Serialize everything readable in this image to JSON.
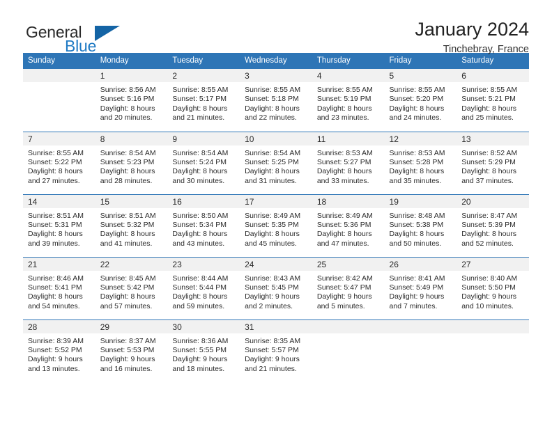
{
  "brand": {
    "name_top": "General",
    "name_bottom": "Blue",
    "flag_icon": "triangle-flag-icon",
    "accent_color": "#1f7ac4"
  },
  "header": {
    "title": "January 2024",
    "subtitle": "Tinchebray, France"
  },
  "theme": {
    "header_row_color": "#2e75b6",
    "daynum_band_color": "#f1f1f1",
    "row_divider_color": "#2e75b6"
  },
  "calendar": {
    "weekday_headers": [
      "Sunday",
      "Monday",
      "Tuesday",
      "Wednesday",
      "Thursday",
      "Friday",
      "Saturday"
    ],
    "weeks": [
      [
        {
          "day": "",
          "empty": true,
          "sunrise": "",
          "sunset": "",
          "daylight1": "",
          "daylight2": ""
        },
        {
          "day": "1",
          "empty": false,
          "sunrise": "Sunrise: 8:56 AM",
          "sunset": "Sunset: 5:16 PM",
          "daylight1": "Daylight: 8 hours",
          "daylight2": "and 20 minutes."
        },
        {
          "day": "2",
          "empty": false,
          "sunrise": "Sunrise: 8:55 AM",
          "sunset": "Sunset: 5:17 PM",
          "daylight1": "Daylight: 8 hours",
          "daylight2": "and 21 minutes."
        },
        {
          "day": "3",
          "empty": false,
          "sunrise": "Sunrise: 8:55 AM",
          "sunset": "Sunset: 5:18 PM",
          "daylight1": "Daylight: 8 hours",
          "daylight2": "and 22 minutes."
        },
        {
          "day": "4",
          "empty": false,
          "sunrise": "Sunrise: 8:55 AM",
          "sunset": "Sunset: 5:19 PM",
          "daylight1": "Daylight: 8 hours",
          "daylight2": "and 23 minutes."
        },
        {
          "day": "5",
          "empty": false,
          "sunrise": "Sunrise: 8:55 AM",
          "sunset": "Sunset: 5:20 PM",
          "daylight1": "Daylight: 8 hours",
          "daylight2": "and 24 minutes."
        },
        {
          "day": "6",
          "empty": false,
          "sunrise": "Sunrise: 8:55 AM",
          "sunset": "Sunset: 5:21 PM",
          "daylight1": "Daylight: 8 hours",
          "daylight2": "and 25 minutes."
        }
      ],
      [
        {
          "day": "7",
          "empty": false,
          "sunrise": "Sunrise: 8:55 AM",
          "sunset": "Sunset: 5:22 PM",
          "daylight1": "Daylight: 8 hours",
          "daylight2": "and 27 minutes."
        },
        {
          "day": "8",
          "empty": false,
          "sunrise": "Sunrise: 8:54 AM",
          "sunset": "Sunset: 5:23 PM",
          "daylight1": "Daylight: 8 hours",
          "daylight2": "and 28 minutes."
        },
        {
          "day": "9",
          "empty": false,
          "sunrise": "Sunrise: 8:54 AM",
          "sunset": "Sunset: 5:24 PM",
          "daylight1": "Daylight: 8 hours",
          "daylight2": "and 30 minutes."
        },
        {
          "day": "10",
          "empty": false,
          "sunrise": "Sunrise: 8:54 AM",
          "sunset": "Sunset: 5:25 PM",
          "daylight1": "Daylight: 8 hours",
          "daylight2": "and 31 minutes."
        },
        {
          "day": "11",
          "empty": false,
          "sunrise": "Sunrise: 8:53 AM",
          "sunset": "Sunset: 5:27 PM",
          "daylight1": "Daylight: 8 hours",
          "daylight2": "and 33 minutes."
        },
        {
          "day": "12",
          "empty": false,
          "sunrise": "Sunrise: 8:53 AM",
          "sunset": "Sunset: 5:28 PM",
          "daylight1": "Daylight: 8 hours",
          "daylight2": "and 35 minutes."
        },
        {
          "day": "13",
          "empty": false,
          "sunrise": "Sunrise: 8:52 AM",
          "sunset": "Sunset: 5:29 PM",
          "daylight1": "Daylight: 8 hours",
          "daylight2": "and 37 minutes."
        }
      ],
      [
        {
          "day": "14",
          "empty": false,
          "sunrise": "Sunrise: 8:51 AM",
          "sunset": "Sunset: 5:31 PM",
          "daylight1": "Daylight: 8 hours",
          "daylight2": "and 39 minutes."
        },
        {
          "day": "15",
          "empty": false,
          "sunrise": "Sunrise: 8:51 AM",
          "sunset": "Sunset: 5:32 PM",
          "daylight1": "Daylight: 8 hours",
          "daylight2": "and 41 minutes."
        },
        {
          "day": "16",
          "empty": false,
          "sunrise": "Sunrise: 8:50 AM",
          "sunset": "Sunset: 5:34 PM",
          "daylight1": "Daylight: 8 hours",
          "daylight2": "and 43 minutes."
        },
        {
          "day": "17",
          "empty": false,
          "sunrise": "Sunrise: 8:49 AM",
          "sunset": "Sunset: 5:35 PM",
          "daylight1": "Daylight: 8 hours",
          "daylight2": "and 45 minutes."
        },
        {
          "day": "18",
          "empty": false,
          "sunrise": "Sunrise: 8:49 AM",
          "sunset": "Sunset: 5:36 PM",
          "daylight1": "Daylight: 8 hours",
          "daylight2": "and 47 minutes."
        },
        {
          "day": "19",
          "empty": false,
          "sunrise": "Sunrise: 8:48 AM",
          "sunset": "Sunset: 5:38 PM",
          "daylight1": "Daylight: 8 hours",
          "daylight2": "and 50 minutes."
        },
        {
          "day": "20",
          "empty": false,
          "sunrise": "Sunrise: 8:47 AM",
          "sunset": "Sunset: 5:39 PM",
          "daylight1": "Daylight: 8 hours",
          "daylight2": "and 52 minutes."
        }
      ],
      [
        {
          "day": "21",
          "empty": false,
          "sunrise": "Sunrise: 8:46 AM",
          "sunset": "Sunset: 5:41 PM",
          "daylight1": "Daylight: 8 hours",
          "daylight2": "and 54 minutes."
        },
        {
          "day": "22",
          "empty": false,
          "sunrise": "Sunrise: 8:45 AM",
          "sunset": "Sunset: 5:42 PM",
          "daylight1": "Daylight: 8 hours",
          "daylight2": "and 57 minutes."
        },
        {
          "day": "23",
          "empty": false,
          "sunrise": "Sunrise: 8:44 AM",
          "sunset": "Sunset: 5:44 PM",
          "daylight1": "Daylight: 8 hours",
          "daylight2": "and 59 minutes."
        },
        {
          "day": "24",
          "empty": false,
          "sunrise": "Sunrise: 8:43 AM",
          "sunset": "Sunset: 5:45 PM",
          "daylight1": "Daylight: 9 hours",
          "daylight2": "and 2 minutes."
        },
        {
          "day": "25",
          "empty": false,
          "sunrise": "Sunrise: 8:42 AM",
          "sunset": "Sunset: 5:47 PM",
          "daylight1": "Daylight: 9 hours",
          "daylight2": "and 5 minutes."
        },
        {
          "day": "26",
          "empty": false,
          "sunrise": "Sunrise: 8:41 AM",
          "sunset": "Sunset: 5:49 PM",
          "daylight1": "Daylight: 9 hours",
          "daylight2": "and 7 minutes."
        },
        {
          "day": "27",
          "empty": false,
          "sunrise": "Sunrise: 8:40 AM",
          "sunset": "Sunset: 5:50 PM",
          "daylight1": "Daylight: 9 hours",
          "daylight2": "and 10 minutes."
        }
      ],
      [
        {
          "day": "28",
          "empty": false,
          "sunrise": "Sunrise: 8:39 AM",
          "sunset": "Sunset: 5:52 PM",
          "daylight1": "Daylight: 9 hours",
          "daylight2": "and 13 minutes."
        },
        {
          "day": "29",
          "empty": false,
          "sunrise": "Sunrise: 8:37 AM",
          "sunset": "Sunset: 5:53 PM",
          "daylight1": "Daylight: 9 hours",
          "daylight2": "and 16 minutes."
        },
        {
          "day": "30",
          "empty": false,
          "sunrise": "Sunrise: 8:36 AM",
          "sunset": "Sunset: 5:55 PM",
          "daylight1": "Daylight: 9 hours",
          "daylight2": "and 18 minutes."
        },
        {
          "day": "31",
          "empty": false,
          "sunrise": "Sunrise: 8:35 AM",
          "sunset": "Sunset: 5:57 PM",
          "daylight1": "Daylight: 9 hours",
          "daylight2": "and 21 minutes."
        },
        {
          "day": "",
          "empty": true,
          "sunrise": "",
          "sunset": "",
          "daylight1": "",
          "daylight2": ""
        },
        {
          "day": "",
          "empty": true,
          "sunrise": "",
          "sunset": "",
          "daylight1": "",
          "daylight2": ""
        },
        {
          "day": "",
          "empty": true,
          "sunrise": "",
          "sunset": "",
          "daylight1": "",
          "daylight2": ""
        }
      ]
    ]
  }
}
